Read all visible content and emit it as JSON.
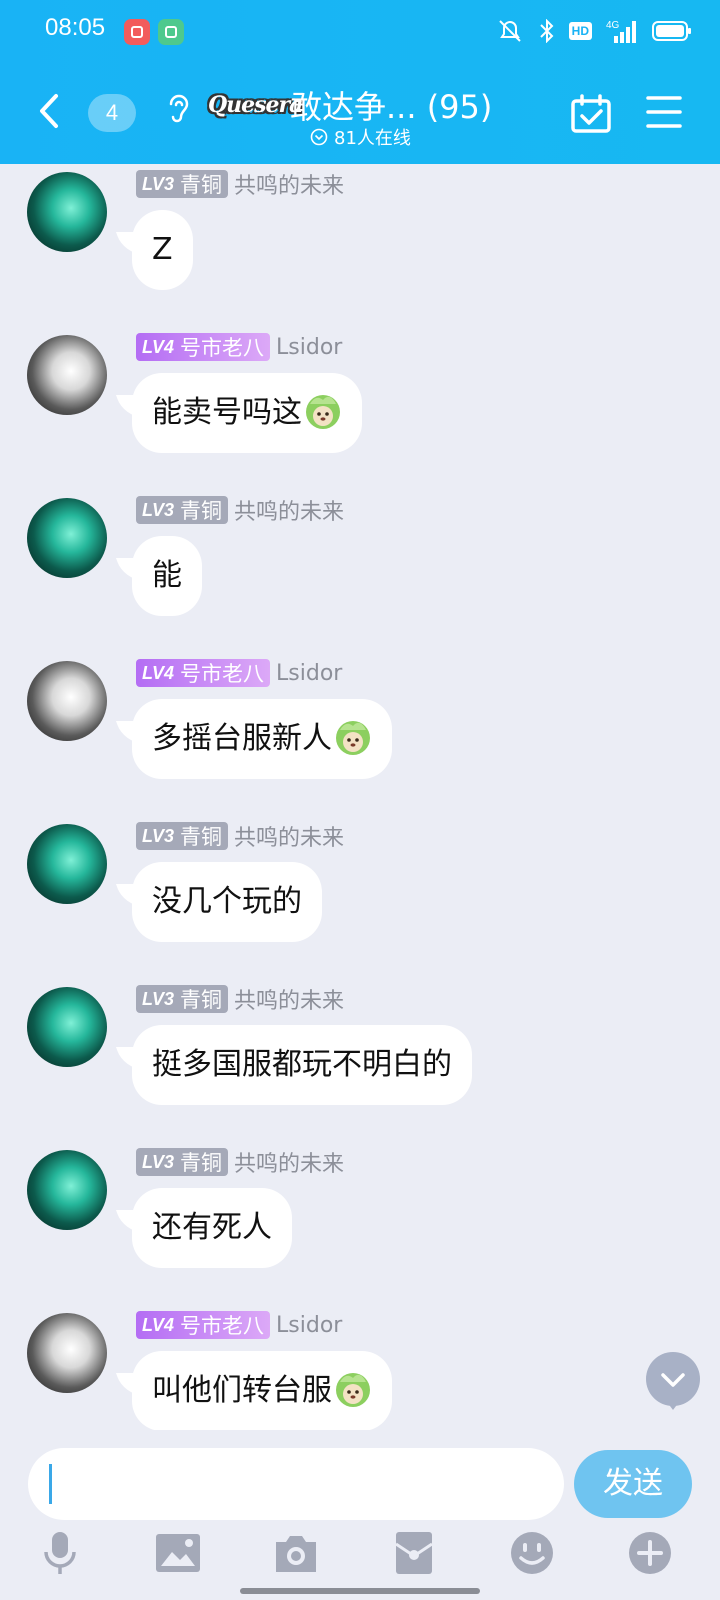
{
  "status": {
    "time": "08:05",
    "hd": "HD",
    "network": "4G"
  },
  "header": {
    "unread_count": "4",
    "group_logo_text": "Quesera",
    "group_name": "敢达争... (95)",
    "online_text": "81人在线"
  },
  "messages": [
    {
      "level": "LV3",
      "rank": "青铜",
      "badge_color": "#a5a9b8",
      "nickname": "共鸣的未来",
      "text": "Z",
      "emoji": ""
    },
    {
      "level": "LV4",
      "rank": "号市老八",
      "badge_color": "#b46df4",
      "nickname": "Lsidor",
      "text": "能卖号吗这",
      "emoji": "cabbage-face-emoji"
    },
    {
      "level": "LV3",
      "rank": "青铜",
      "badge_color": "#a5a9b8",
      "nickname": "共鸣的未来",
      "text": "能",
      "emoji": ""
    },
    {
      "level": "LV4",
      "rank": "号市老八",
      "badge_color": "#b46df4",
      "nickname": "Lsidor",
      "text": "多摇台服新人",
      "emoji": "cabbage-face-emoji"
    },
    {
      "level": "LV3",
      "rank": "青铜",
      "badge_color": "#a5a9b8",
      "nickname": "共鸣的未来",
      "text": "没几个玩的",
      "emoji": ""
    },
    {
      "level": "LV3",
      "rank": "青铜",
      "badge_color": "#a5a9b8",
      "nickname": "共鸣的未来",
      "text": "挺多国服都玩不明白的",
      "emoji": ""
    },
    {
      "level": "LV3",
      "rank": "青铜",
      "badge_color": "#a5a9b8",
      "nickname": "共鸣的未来",
      "text": "还有死人",
      "emoji": ""
    },
    {
      "level": "LV4",
      "rank": "号市老八",
      "badge_color": "#b46df4",
      "nickname": "Lsidor",
      "text": "叫他们转台服",
      "emoji": "cabbage-face-emoji"
    }
  ],
  "input": {
    "value": "",
    "placeholder": ""
  },
  "send_label": "发送",
  "toolbar": [
    "microphone-icon",
    "image-icon",
    "camera-icon",
    "red-packet-icon",
    "emoji-icon",
    "plus-icon"
  ],
  "colors": {
    "header": "#19b3f5",
    "background": "#ebedf5",
    "send_button": "#6fc4f0"
  }
}
